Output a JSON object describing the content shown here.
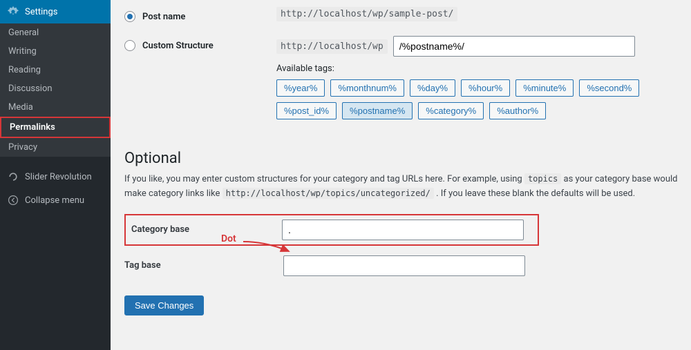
{
  "sidebar": {
    "header": "Settings",
    "items": [
      "General",
      "Writing",
      "Reading",
      "Discussion",
      "Media",
      "Permalinks",
      "Privacy"
    ],
    "current": "Permalinks",
    "slider": "Slider Revolution",
    "collapse": "Collapse menu"
  },
  "permalink_options": {
    "postname": {
      "label": "Post name",
      "url": "http://localhost/wp/sample-post/"
    },
    "custom": {
      "label": "Custom Structure",
      "prefix": "http://localhost/wp",
      "value": "/%postname%/"
    }
  },
  "tags": {
    "label": "Available tags:",
    "list": [
      "%year%",
      "%monthnum%",
      "%day%",
      "%hour%",
      "%minute%",
      "%second%",
      "%post_id%",
      "%postname%",
      "%category%",
      "%author%"
    ],
    "active": "%postname%"
  },
  "optional": {
    "heading": "Optional",
    "desc_pre": "If you like, you may enter custom structures for your category and tag URLs here. For example, using ",
    "desc_code1": "topics",
    "desc_mid": " as your category base would make category links like ",
    "desc_code2": "http://localhost/wp/topics/uncategorized/",
    "desc_post": " . If you leave these blank the defaults will be used.",
    "category_label": "Category base",
    "category_value": ".",
    "tag_label": "Tag base",
    "tag_value": ""
  },
  "save": "Save Changes",
  "annotation": "Dot"
}
